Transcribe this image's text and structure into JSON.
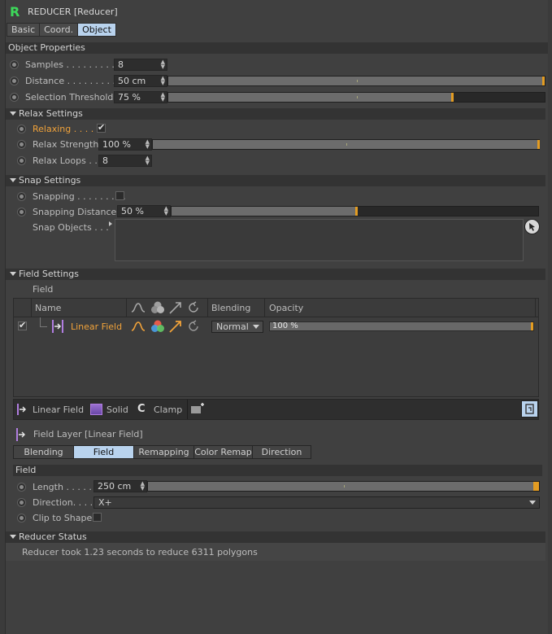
{
  "window": {
    "title": "REDUCER [Reducer]",
    "logo": "R"
  },
  "tabs": [
    {
      "label": "Basic",
      "active": false
    },
    {
      "label": "Coord.",
      "active": false
    },
    {
      "label": "Object",
      "active": true
    }
  ],
  "object_properties": {
    "header": "Object Properties",
    "samples": {
      "label": "Samples . . . . . . . . . .",
      "value": "8"
    },
    "distance": {
      "label": "Distance . . . . . . . . . .",
      "value": "50 cm",
      "level": 1.0
    },
    "selection_threshold": {
      "label": "Selection Threshold",
      "value": "75 %",
      "level": 0.75
    }
  },
  "relax": {
    "header": "Relax Settings",
    "relaxing": {
      "label": "Relaxing . . . . .",
      "checked": true
    },
    "strength": {
      "label": "Relax Strength",
      "value": "100 %",
      "level": 1.0
    },
    "loops": {
      "label": "Relax Loops . .",
      "value": "8"
    }
  },
  "snap": {
    "header": "Snap Settings",
    "snapping": {
      "label": "Snapping . . . . . . . . .",
      "checked": false
    },
    "distance": {
      "label": "Snapping Distance",
      "value": "50 %",
      "level": 0.5
    },
    "objects": {
      "label": "Snap Objects . . ."
    }
  },
  "field_settings": {
    "header": "Field Settings",
    "field_label": "Field",
    "columns": {
      "name": "Name",
      "blending": "Blending",
      "opacity": "Opacity"
    },
    "rows": [
      {
        "name": "Linear Field",
        "blending": "Normal",
        "opacity": "100 %",
        "enabled": true
      }
    ],
    "toolbar": {
      "linear": "Linear Field",
      "solid": "Solid",
      "clamp": "Clamp"
    },
    "layer_title": "Field Layer [Linear Field]",
    "sub_tabs": [
      {
        "label": "Blending",
        "active": false
      },
      {
        "label": "Field",
        "active": true
      },
      {
        "label": "Remapping",
        "active": false
      },
      {
        "label": "Color Remap",
        "active": false
      },
      {
        "label": "Direction",
        "active": false
      }
    ],
    "field_section": "Field",
    "length": {
      "label": "Length . . . . .",
      "value": "250 cm",
      "level": 1.0
    },
    "direction": {
      "label": "Direction. . . .",
      "value": "X+"
    },
    "clip": {
      "label": "Clip to Shape",
      "checked": false
    }
  },
  "status": {
    "header": "Reducer Status",
    "message": "Reducer took 1.23 seconds to reduce 6311 polygons"
  },
  "colors": {
    "accent_orange": "#e39c22",
    "active_tab": "#b9d3ee",
    "logo_green": "#3dd95a",
    "field_purple": "#b07de0"
  },
  "icons": [
    "falloff-curve-icon",
    "color-mix-icon",
    "direction-arrow-icon",
    "refresh-icon",
    "cursor-pick-icon",
    "add-layer-icon",
    "lock-icon"
  ]
}
